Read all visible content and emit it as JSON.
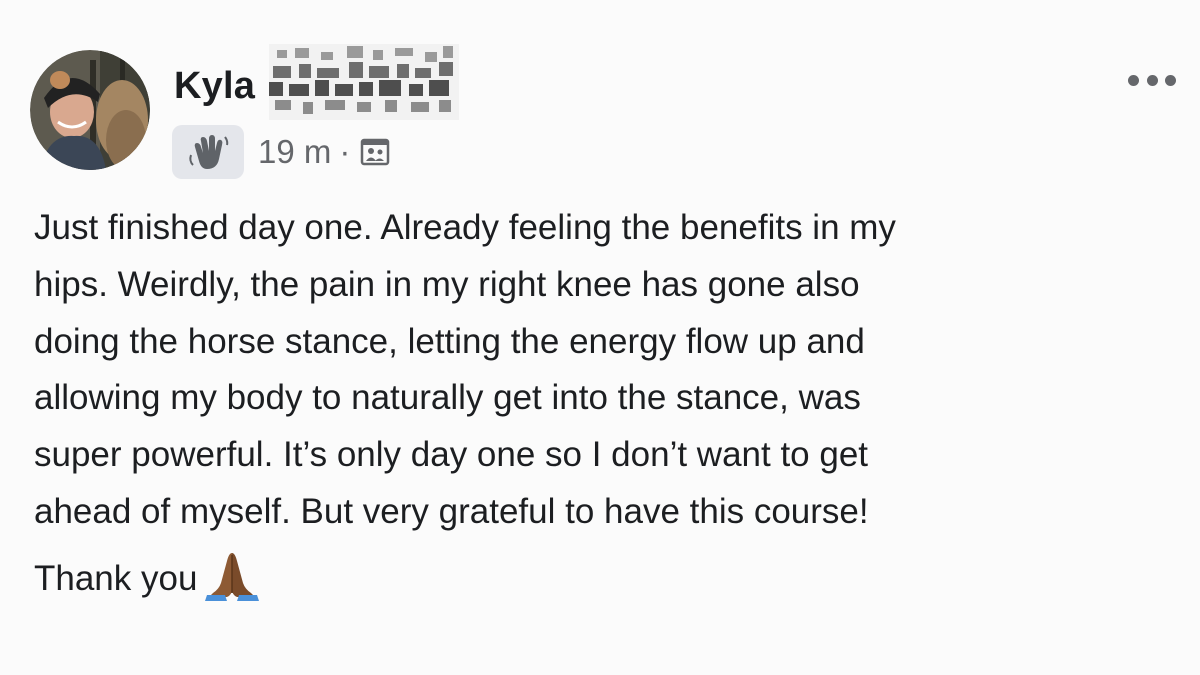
{
  "post": {
    "author_first_name": "Kyla",
    "time": "19 m",
    "separator": "·",
    "badge_icon": "waving-hand-icon",
    "audience_icon": "group-audience-icon",
    "menu_icon": "more-options-icon",
    "body_lines": [
      "Just finished day one. Already feeling the benefits in my",
      "hips. Weirdly, the pain in my right knee has gone also",
      "doing the horse stance, letting the energy flow up and",
      "allowing my body to naturally get into the stance, was",
      "super powerful. It’s only day one so I don’t want to get",
      "ahead of myself. But very grateful to have this course!"
    ],
    "closing": "Thank you",
    "closing_emoji": "folded-hands-icon"
  },
  "colors": {
    "text": "#1c1e21",
    "secondary": "#65676b",
    "badge_bg": "#e4e6eb",
    "background": "#fbfbfb"
  }
}
